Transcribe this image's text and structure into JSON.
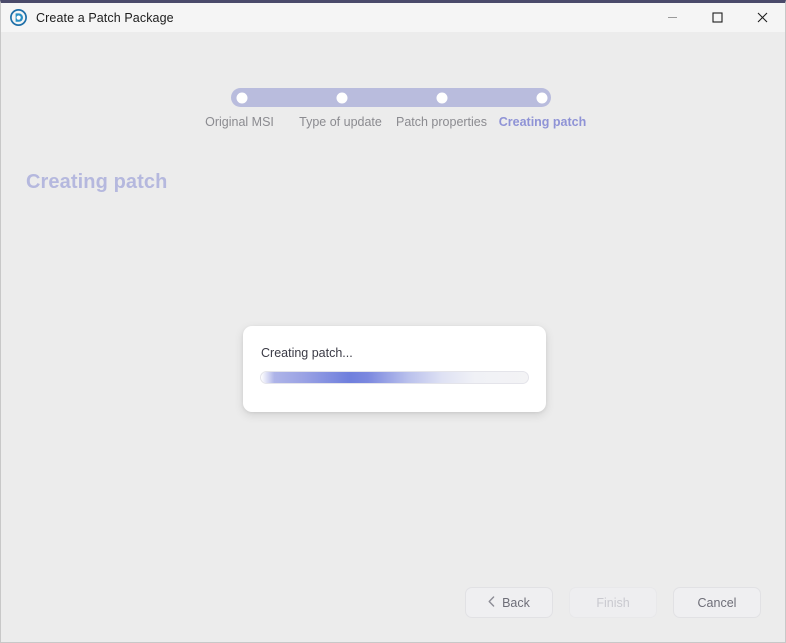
{
  "window": {
    "title": "Create a Patch Package",
    "app_icon": "app-logo-icon",
    "accent_top_border": "#4a4a6a",
    "background": "#ececec",
    "titlebar_background": "#f5f5f5",
    "controls": {
      "minimize": "minimize-icon",
      "maximize": "maximize-icon",
      "close": "close-icon"
    }
  },
  "stepper": {
    "active_index": 3,
    "track_color": "#b9bcdd",
    "active_label_color": "#8f93d6",
    "inactive_label_color": "#8b8b90",
    "steps": [
      {
        "label": "Original MSI"
      },
      {
        "label": "Type of update"
      },
      {
        "label": "Patch properties"
      },
      {
        "label": "Creating patch"
      }
    ]
  },
  "page": {
    "heading": "Creating patch",
    "heading_color": "#b5b8de"
  },
  "progress_dialog": {
    "label": "Creating patch...",
    "bar_style": "indeterminate",
    "bar_gradient_from": "#6f7fdd",
    "bar_track": "#f2f2f4"
  },
  "footer": {
    "buttons": [
      {
        "name": "back",
        "label": "Back",
        "icon": "chevron-left-icon",
        "disabled": false
      },
      {
        "name": "finish",
        "label": "Finish",
        "icon": null,
        "disabled": true
      },
      {
        "name": "cancel",
        "label": "Cancel",
        "icon": null,
        "disabled": false
      }
    ]
  }
}
